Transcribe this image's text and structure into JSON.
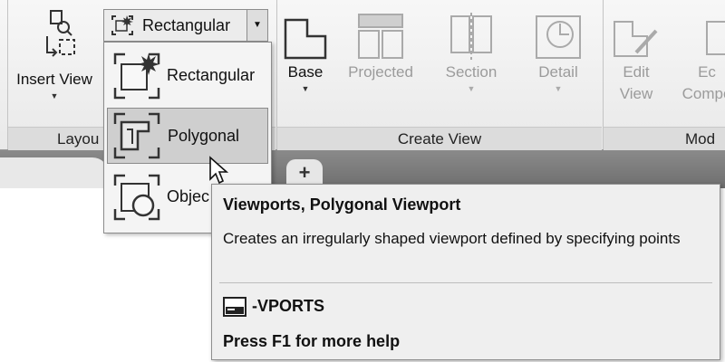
{
  "ribbon": {
    "insert_view": {
      "label": "Insert View"
    },
    "split_button_label": "Rectangular",
    "panels": {
      "layout_label": "Layou",
      "create_view_label": "Create View",
      "modify_label": "Mod"
    },
    "tools": {
      "base": "Base",
      "projected": "Projected",
      "section": "Section",
      "detail": "Detail",
      "edit_view_line1": "Edit",
      "edit_view_line2": "View",
      "edit_comp_line1": "Ec",
      "edit_comp_line2": "Compo"
    }
  },
  "tabs": {
    "new_tab": "+"
  },
  "dropdown": {
    "items": [
      {
        "label": "Rectangular",
        "icon": "rectangular-viewport-icon"
      },
      {
        "label": "Polygonal",
        "icon": "polygonal-viewport-icon",
        "selected": true
      },
      {
        "label": "Objec",
        "icon": "object-viewport-icon"
      }
    ]
  },
  "tooltip": {
    "title": "Viewports, Polygonal Viewport",
    "description": "Creates an irregularly shaped viewport defined by specifying points",
    "command": "-VPORTS",
    "help": "Press F1 for more help"
  }
}
